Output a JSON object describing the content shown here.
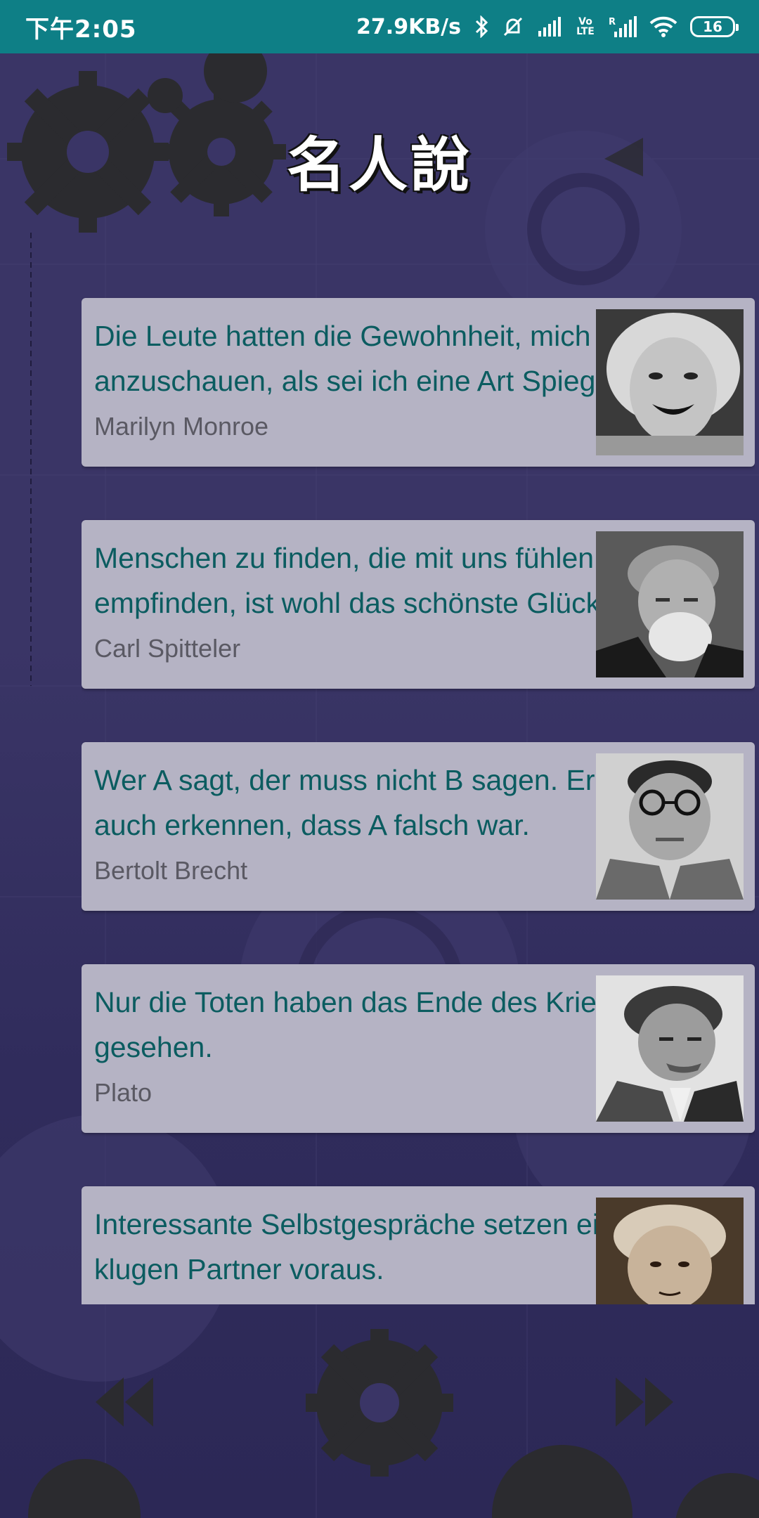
{
  "status_bar": {
    "time": "下午2:05",
    "network_speed": "27.9KB/s",
    "volte_label": "Vo LTE",
    "battery_level": "16",
    "icons": [
      "bluetooth-icon",
      "alarm-off-icon",
      "signal-icon",
      "volte-icon",
      "signal-roaming-icon",
      "wifi-icon",
      "battery-icon"
    ]
  },
  "header": {
    "title": "名人說"
  },
  "quotes": [
    {
      "text": "Die Leute hatten die Gewohnheit, mich anzuschauen, als sei ich eine Art Spiegel statt eines Menschen.",
      "author": "Marilyn Monroe",
      "portrait_icon": "portrait-marilyn-monroe"
    },
    {
      "text": "Menschen zu finden, die mit uns fühlen und empfinden, ist wohl das schönste Glück auf Erden.",
      "author": "Carl Spitteler",
      "portrait_icon": "portrait-carl-spitteler"
    },
    {
      "text": "Wer A sagt, der muss nicht B sagen. Er kann auch erkennen, dass A falsch war.",
      "author": "Bertolt Brecht",
      "portrait_icon": "portrait-bertolt-brecht"
    },
    {
      "text": "Nur die Toten haben das Ende des Krieges gesehen.",
      "author": "Plato",
      "portrait_icon": "portrait-plato"
    },
    {
      "text": "Interessante Selbstgespräche setzen einen klugen Partner voraus.",
      "author": "",
      "portrait_icon": "portrait-kant"
    }
  ],
  "navigation": {
    "prev_icon": "rewind-icon",
    "next_icon": "fast-forward-icon"
  },
  "colors": {
    "status_bar": "#0e7f86",
    "background": "#3a3566",
    "card": "#b5b3c4",
    "quote_text": "#0b5c60",
    "author_text": "#5a5963"
  }
}
